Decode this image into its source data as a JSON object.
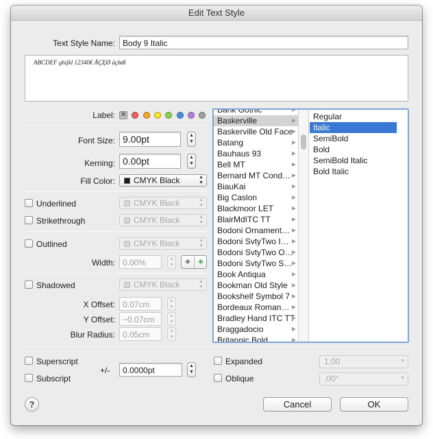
{
  "window": {
    "title": "Edit Text Style"
  },
  "style_name": {
    "label": "Text Style Name:",
    "value": "Body 9 Italic"
  },
  "preview": {
    "text": "ABCDEF ghijkl 12340€ ÄÇĘØ äçłøß"
  },
  "label_row": {
    "label": "Label:",
    "none_glyph": "✕",
    "colors": [
      "#f25f5c",
      "#f5a623",
      "#f8e71c",
      "#8bd34d",
      "#4a90e2",
      "#b57edc",
      "#a0a0a0"
    ]
  },
  "font_size": {
    "label": "Font Size:",
    "value": "9.00pt"
  },
  "kerning": {
    "label": "Kerning:",
    "value": "0.00pt"
  },
  "fill_color": {
    "label": "Fill Color:",
    "value": "CMYK Black",
    "swatch": "#1a1a1a"
  },
  "underlined": {
    "label": "Underlined",
    "color": "CMYK Black"
  },
  "strikethrough": {
    "label": "Strikethrough",
    "color": "CMYK Black"
  },
  "outlined": {
    "label": "Outlined",
    "color": "CMYK Black",
    "width_label": "Width:",
    "width_value": "0.00%"
  },
  "shadowed": {
    "label": "Shadowed",
    "color": "CMYK Black",
    "x_offset_label": "X Offset:",
    "x_offset": "0.07cm",
    "y_offset_label": "Y Offset:",
    "y_offset": "−0.07cm",
    "blur_label": "Blur Radius:",
    "blur": "0.05cm"
  },
  "font_families": [
    "Bank Gothic",
    "Baskerville",
    "Baskerville Old Face",
    "Batang",
    "Bauhaus 93",
    "Bell MT",
    "Bernard MT Cond…",
    "BiauKai",
    "Big Caslon",
    "Blackmoor LET",
    "BlairMdITC TT",
    "Bodoni Ornament…",
    "Bodoni SvtyTwo I…",
    "Bodoni SvtyTwo O…",
    "Bodoni SvtyTwo S…",
    "Book Antiqua",
    "Bookman Old Style",
    "Bookshelf Symbol 7",
    "Bordeaux Roman…",
    "Bradley Hand ITC TT",
    "Braggadocio",
    "Britannic Bold"
  ],
  "selected_family": "Baskerville",
  "font_styles": [
    "Regular",
    "Italic",
    "SemiBold",
    "Bold",
    "SemiBold Italic",
    "Bold Italic"
  ],
  "selected_style": "Italic",
  "superscript": {
    "label": "Superscript"
  },
  "subscript": {
    "label": "Subscript"
  },
  "baseline": {
    "label": "+/-",
    "value": "0.0000pt"
  },
  "expanded": {
    "label": "Expanded",
    "value": "1,00"
  },
  "oblique": {
    "label": "Oblique",
    "value": ",00°"
  },
  "buttons": {
    "help": "?",
    "cancel": "Cancel",
    "ok": "OK"
  }
}
